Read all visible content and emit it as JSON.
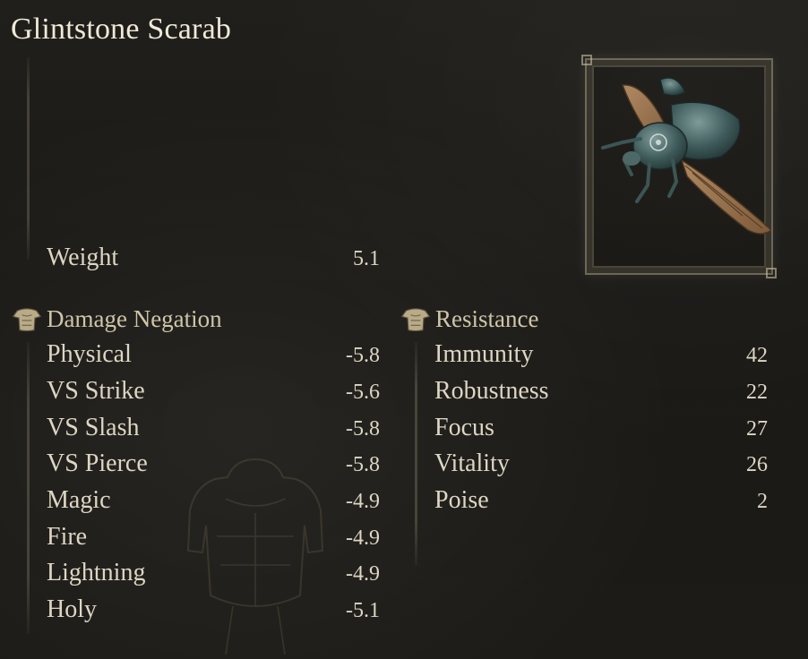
{
  "item": {
    "name": "Glintstone Scarab",
    "icon": "scarab-helm-icon"
  },
  "weight": {
    "label": "Weight",
    "value": "5.1"
  },
  "damage_negation": {
    "heading": "Damage Negation",
    "icon": "armor-icon",
    "rows": [
      {
        "label": "Physical",
        "value": "-5.8"
      },
      {
        "label": "VS Strike",
        "value": "-5.6"
      },
      {
        "label": "VS Slash",
        "value": "-5.8"
      },
      {
        "label": "VS Pierce",
        "value": "-5.8"
      },
      {
        "label": "Magic",
        "value": "-4.9"
      },
      {
        "label": "Fire",
        "value": "-4.9"
      },
      {
        "label": "Lightning",
        "value": "-4.9"
      },
      {
        "label": "Holy",
        "value": "-5.1"
      }
    ]
  },
  "resistance": {
    "heading": "Resistance",
    "icon": "armor-icon",
    "rows": [
      {
        "label": "Immunity",
        "value": "42"
      },
      {
        "label": "Robustness",
        "value": "22"
      },
      {
        "label": "Focus",
        "value": "27"
      },
      {
        "label": "Vitality",
        "value": "26"
      },
      {
        "label": "Poise",
        "value": "2"
      }
    ]
  },
  "colors": {
    "text": "#ddd6c4",
    "heading": "#cfc5a8",
    "background": "#1d1b17"
  }
}
